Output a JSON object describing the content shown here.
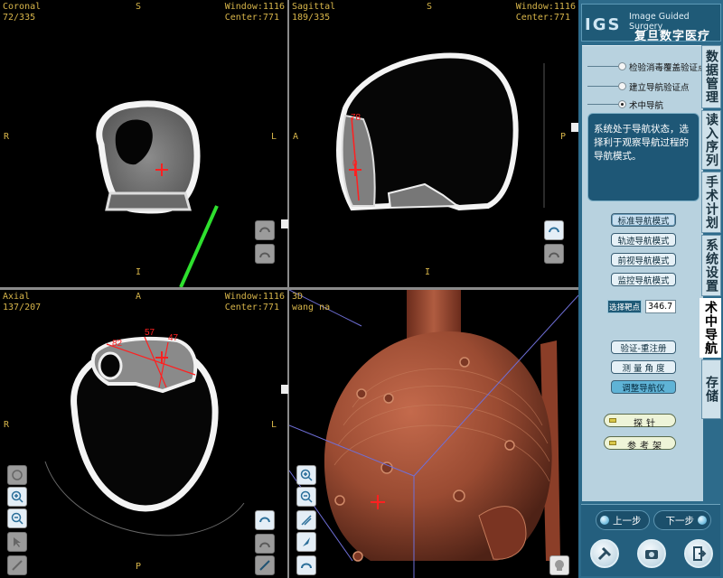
{
  "viewports": {
    "coronal": {
      "name": "Coronal",
      "slice": "72/335",
      "window_label": "Window:",
      "window": "1116",
      "center_label": "Center:",
      "center": "771",
      "top": "S",
      "left": "R",
      "right": "L",
      "bottom": "I"
    },
    "sagittal": {
      "name": "Sagittal",
      "slice": "189/335",
      "window_label": "Window:",
      "window": "1116",
      "center_label": "Center:",
      "center": "771",
      "top": "S",
      "left": "A",
      "right": "P",
      "bottom": "I",
      "measure_a": "78",
      "measure_b": "0"
    },
    "axial": {
      "name": "Axial",
      "slice": "137/207",
      "window_label": "Window:",
      "window": "1116",
      "center_label": "Center:",
      "center": "771",
      "top": "A",
      "left": "R",
      "right": "L",
      "bottom": "P",
      "measure_a": "82",
      "measure_b": "57",
      "measure_c": "47"
    },
    "threeD": {
      "name": "3D",
      "patient": "wang na"
    }
  },
  "panel": {
    "logo": {
      "letters": "IGS",
      "english": "Image Guided Surgery",
      "chinese": "复旦数字医疗"
    },
    "tabs": [
      {
        "label": "数据管理",
        "active": false
      },
      {
        "label": "读入序列",
        "active": false
      },
      {
        "label": "手术计划",
        "active": false
      },
      {
        "label": "系统设置",
        "active": false
      },
      {
        "label": "术中导航",
        "active": true
      },
      {
        "label": "存储",
        "active": false
      }
    ],
    "steps": [
      {
        "label": "检验消毒覆盖验证点",
        "selected": false
      },
      {
        "label": "建立导航验证点",
        "selected": false
      },
      {
        "label": "术中导航",
        "selected": true
      }
    ],
    "status_text": "系统处于导航状态，选择利于观察导航过程的导航模式。",
    "modes": [
      "标准导航模式",
      "轨迹导航模式",
      "前视导航模式",
      "监控导航模式"
    ],
    "target_button": "选择靶点",
    "target_value": "346.7",
    "actions": [
      "验证-重注册",
      "测 量 角 度",
      "调整导航仪"
    ],
    "tools": [
      "探针",
      "参考架"
    ],
    "prev": "上一步",
    "next": "下一步"
  },
  "colors": {
    "overlay_text": "#d7b54a",
    "skin": "#9a4b32",
    "panel_bg": "#2d6b8b",
    "crosshair": "#ff2020",
    "probe": "#2ee02e"
  }
}
